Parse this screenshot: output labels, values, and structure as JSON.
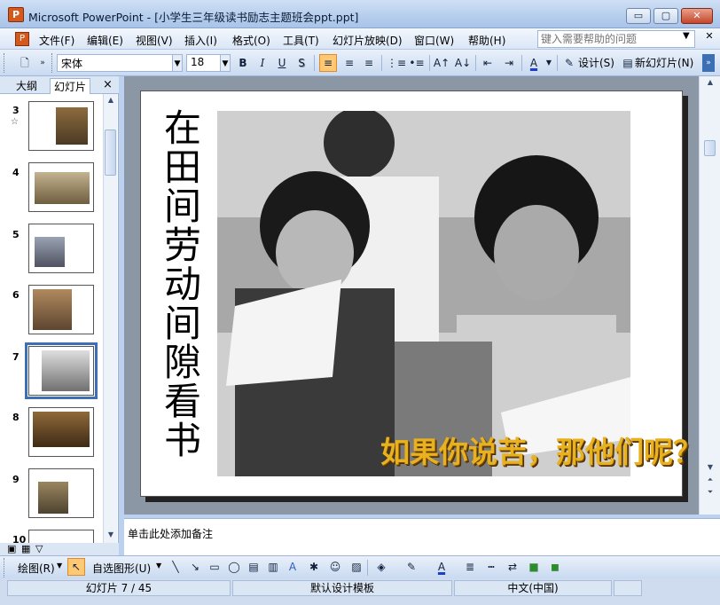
{
  "window": {
    "title": "Microsoft PowerPoint - [小学生三年级读书励志主题班会ppt.ppt]",
    "app_icon": "P",
    "minimize_glyph": "▭",
    "maximize_glyph": "▢",
    "close_glyph": "✕"
  },
  "menubar": {
    "items": [
      "文件(F)",
      "编辑(E)",
      "视图(V)",
      "插入(I)",
      "格式(O)",
      "工具(T)",
      "幻灯片放映(D)",
      "窗口(W)",
      "帮助(H)"
    ],
    "help_placeholder": "键入需要帮助的问题"
  },
  "toolbar": {
    "font_name": "宋体",
    "font_size": "18",
    "bold": "B",
    "italic": "I",
    "underline": "U",
    "shadow": "S",
    "design_label": "设计(S)",
    "new_slide_label": "新幻灯片(N)",
    "accent_color": "#ffc873"
  },
  "outline_pane": {
    "tab_outline": "大纲",
    "tab_slides": "幻灯片",
    "close": "×",
    "slides": [
      {
        "num": "3",
        "has_animation": true
      },
      {
        "num": "4"
      },
      {
        "num": "5"
      },
      {
        "num": "6"
      },
      {
        "num": "7",
        "selected": true
      },
      {
        "num": "8"
      },
      {
        "num": "9"
      },
      {
        "num": "10"
      }
    ]
  },
  "slide": {
    "title": "在田间劳动间隙看书",
    "caption": "如果你说苦，那他们呢？",
    "photo": "black-and-white photo of children reading in a field"
  },
  "notes": {
    "placeholder": "单击此处添加备注"
  },
  "drawbar": {
    "draw_label": "绘图(R)",
    "autoshape_label": "自选图形(U)"
  },
  "status": {
    "slide_info": "幻灯片 7 / 45",
    "template": "默认设计模板",
    "language": "中文(中国)"
  }
}
